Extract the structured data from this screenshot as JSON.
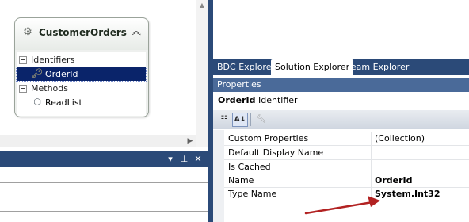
{
  "entity": {
    "title": "CustomerOrders",
    "collapse_glyph": "︽",
    "sections": [
      {
        "label": "Identifiers",
        "items": [
          {
            "label": "OrderId",
            "icon": "key-icon",
            "selected": true
          }
        ]
      },
      {
        "label": "Methods",
        "items": [
          {
            "label": "ReadList",
            "icon": "cube-icon",
            "selected": false
          }
        ]
      }
    ]
  },
  "lower_panel": {
    "buttons": [
      "▾",
      "⊥",
      "✕"
    ]
  },
  "tabs": [
    {
      "label": "BDC Explorer",
      "active": false
    },
    {
      "label": "Solution Explorer",
      "active": true
    },
    {
      "label": "Team Explorer",
      "active": false
    }
  ],
  "properties": {
    "title": "Properties",
    "object_name": "OrderId",
    "object_type": "Identifier",
    "rows": [
      {
        "name": "Custom Properties",
        "value": "(Collection)",
        "bold": false
      },
      {
        "name": "Default Display Name",
        "value": "",
        "bold": false
      },
      {
        "name": "Is Cached",
        "value": "",
        "bold": false
      },
      {
        "name": "Name",
        "value": "OrderId",
        "bold": true
      },
      {
        "name": "Type Name",
        "value": "System.Int32",
        "bold": true
      }
    ]
  },
  "colors": {
    "accent_dark": "#2b4a78",
    "selection": "#0a246a",
    "annotation_arrow": "#b22222"
  }
}
